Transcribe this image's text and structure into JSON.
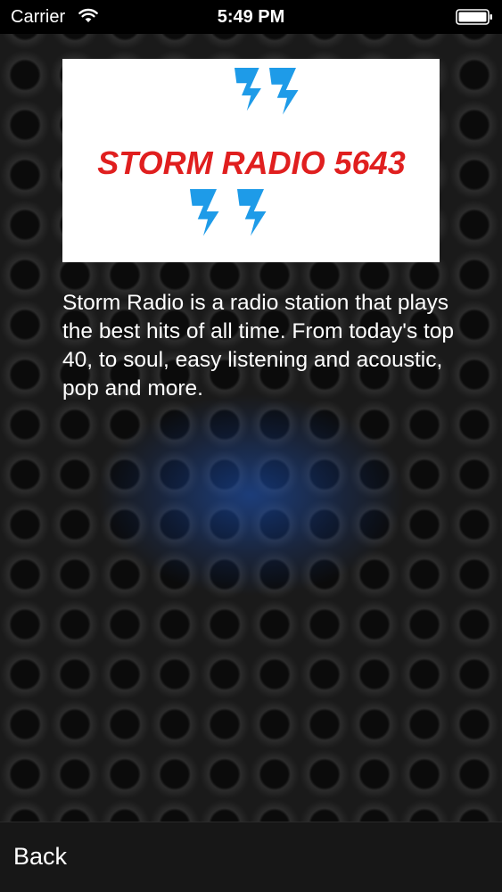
{
  "status_bar": {
    "carrier": "Carrier",
    "time": "5:49 PM",
    "wifi_icon": "wifi-icon",
    "battery_icon": "battery-full-icon"
  },
  "logo": {
    "text": "STORM RADIO 5643",
    "text_color": "#e01f1f",
    "bolt_color": "#1e9be8",
    "icon": "lightning-bolt-icon"
  },
  "description": "Storm Radio is a radio station that plays the best hits of all time. From today's top 40, to soul, easy listening and acoustic, pop and more.",
  "navigation": {
    "back_label": "Back"
  },
  "colors": {
    "background": "#161616",
    "glow": "#1e5ac8",
    "text": "#ffffff"
  }
}
